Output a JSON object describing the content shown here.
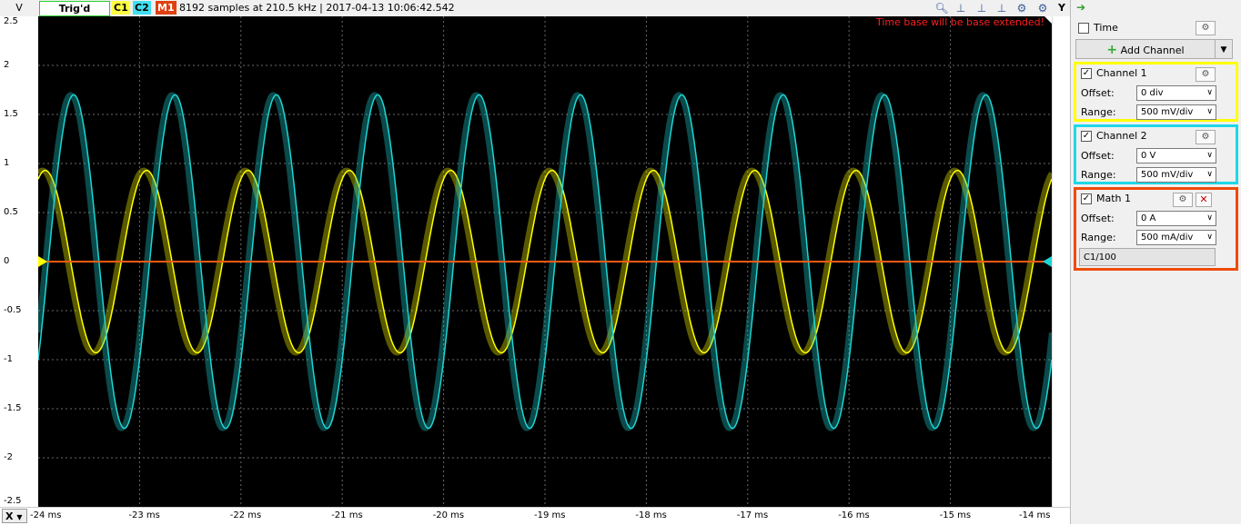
{
  "topbar": {
    "y_unit_label": "V",
    "trigger_status": "Trig'd",
    "badges": [
      {
        "label": "C1",
        "color": "#f0f000"
      },
      {
        "label": "C2",
        "color": "#00d0e0"
      },
      {
        "label": "M1",
        "color": "#f04010"
      }
    ],
    "acquisition_info": "8192 samples at 210.5 kHz | 2017-04-13 10:06:42.542",
    "warning": "Time base will be base extended!",
    "y_axis_button": "Y",
    "icons": [
      "zoom-icon",
      "cursor-a-icon",
      "cursor-b-icon",
      "cursor-c-icon",
      "settings-icon"
    ]
  },
  "axes": {
    "y_ticks": [
      "2.5",
      "2",
      "1.5",
      "1",
      "0.5",
      "0",
      "-0.5",
      "-1",
      "-1.5",
      "-2",
      "-2.5"
    ],
    "x_ticks": [
      "-24 ms",
      "-23 ms",
      "-22 ms",
      "-21 ms",
      "-20 ms",
      "-19 ms",
      "-18 ms",
      "-17 ms",
      "-16 ms",
      "-15 ms",
      "-14 ms"
    ],
    "x_axis_button": "X"
  },
  "chart_data": {
    "type": "line",
    "xlabel": "",
    "ylabel": "V",
    "xlim": [
      -24,
      -14
    ],
    "ylim": [
      -2.5,
      2.5
    ],
    "grid": true,
    "series": [
      {
        "color": "#ffff00",
        "amplitude": 0.93,
        "period_ms": 1.0,
        "phase_ms": -23.93,
        "note_peaks_start": -23.65
      },
      {
        "color": "#1fd4d4",
        "amplitude": 1.7,
        "period_ms": 1.0,
        "phase_ms": -23.65
      },
      {
        "color": "#ff5a14",
        "amplitude": 0.0,
        "period_ms": 1.0,
        "phase_ms": 0
      }
    ]
  },
  "panel": {
    "time_label": "Time",
    "add_channel_label": "Add Channel",
    "channel1": {
      "title": "Channel 1",
      "border": "#ffff00",
      "offset_label": "Offset:",
      "offset_value": "0 div",
      "range_label": "Range:",
      "range_value": "500 mV/div"
    },
    "channel2": {
      "title": "Channel 2",
      "border": "#1ed8e8",
      "offset_label": "Offset:",
      "offset_value": "0 V",
      "range_label": "Range:",
      "range_value": "500 mV/div"
    },
    "math1": {
      "title": "Math 1",
      "border": "#f04a0a",
      "offset_label": "Offset:",
      "offset_value": "0 A",
      "range_label": "Range:",
      "range_value": "500 mA/div",
      "formula": "C1/100"
    }
  }
}
